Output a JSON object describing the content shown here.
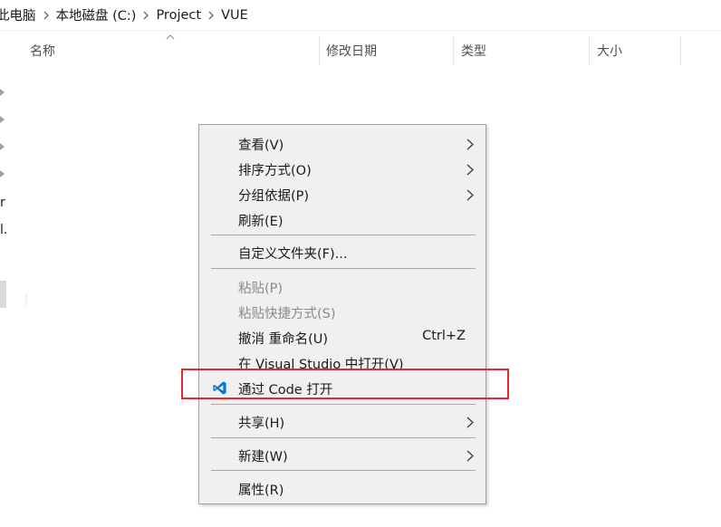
{
  "breadcrumb": {
    "items": [
      "此电脑",
      "本地磁盘 (C:)",
      "Project",
      "VUE"
    ]
  },
  "columns": [
    {
      "label": "名称"
    },
    {
      "label": "修改日期"
    },
    {
      "label": "类型"
    },
    {
      "label": "大小"
    }
  ],
  "nav": {
    "fragments": [
      "r",
      "l."
    ]
  },
  "menu": {
    "view": {
      "label": "查看(V)"
    },
    "sort": {
      "label": "排序方式(O)"
    },
    "group": {
      "label": "分组依据(P)"
    },
    "refresh": {
      "label": "刷新(E)"
    },
    "customize": {
      "label": "自定义文件夹(F)..."
    },
    "paste": {
      "label": "粘贴(P)"
    },
    "paste_shortcut": {
      "label": "粘贴快捷方式(S)"
    },
    "undo": {
      "label": "撤消 重命名(U)",
      "shortcut": "Ctrl+Z"
    },
    "open_vs": {
      "label": "在 Visual Studio 中打开(V)"
    },
    "open_code": {
      "label": "通过 Code 打开",
      "icon": "vscode-icon"
    },
    "share": {
      "label": "共享(H)"
    },
    "new": {
      "label": "新建(W)"
    },
    "properties": {
      "label": "属性(R)"
    }
  },
  "colors": {
    "highlight": "#e8262a",
    "vscode_blue": "#0078d4",
    "menu_bg": "#f0f0f0"
  }
}
